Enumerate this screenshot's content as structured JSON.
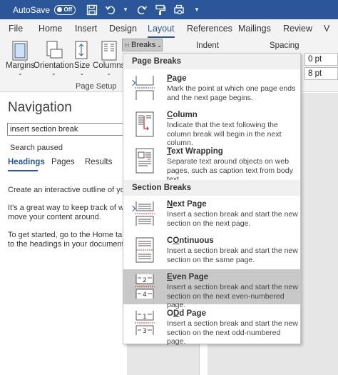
{
  "titlebar": {
    "autosave_label": "AutoSave",
    "autosave_state": "Off",
    "qat_icons": [
      "save-icon",
      "undo-icon",
      "redo-icon",
      "format-painter-icon",
      "print-preview-icon",
      "customize-qat-icon"
    ]
  },
  "tabs": [
    "File",
    "Home",
    "Insert",
    "Design",
    "Layout",
    "References",
    "Mailings",
    "Review",
    "V"
  ],
  "active_tab": "Layout",
  "ribbon": {
    "margins": "Margins",
    "orientation": "Orientation",
    "size": "Size",
    "columns": "Columns",
    "breaks": "Breaks",
    "group_page_setup": "Page Setup",
    "indent": "Indent",
    "spacing": "Spacing",
    "spacing_before": "0 pt",
    "spacing_after": "8 pt"
  },
  "nav": {
    "title": "Navigation",
    "search_value": "insert section break",
    "status": "Search paused",
    "tabs": [
      "Headings",
      "Pages",
      "Results"
    ],
    "p1": "Create an interactive outline of your do",
    "p2_l1": "It's a great way to keep track of where y",
    "p2_l2": "move your content around.",
    "p3_l1": "To get started, go to the Home tab and",
    "p3_l2": "to the headings in your document."
  },
  "breaks_menu": {
    "page_breaks_header": "Page Breaks",
    "section_breaks_header": "Section Breaks",
    "items": [
      {
        "title": "Page",
        "u": "P",
        "rest": "age",
        "desc": "Mark the point at which one page ends and the next page begins."
      },
      {
        "title": "Column",
        "u": "C",
        "rest": "olumn",
        "desc": "Indicate that the text following the column break will begin in the next column."
      },
      {
        "title": "Text Wrapping",
        "u": "T",
        "rest": "ext Wrapping",
        "desc": "Separate text around objects on web pages, such as caption text from body text."
      },
      {
        "title": "Next Page",
        "u": "N",
        "rest": "ext Page",
        "desc": "Insert a section break and start the new section on the next page."
      },
      {
        "title": "Continuous",
        "u": "O",
        "rest": "ntinuous",
        "desc": "Insert a section break and start the new section on the same page."
      },
      {
        "title": "Even Page",
        "u": "E",
        "rest": "ven Page",
        "desc": "Insert a section break and start the new section on the next even-numbered page."
      },
      {
        "title": "Odd Page",
        "u": "D",
        "rest": "d Page",
        "desc": "Insert a section break and start the new section on the next odd-numbered page."
      }
    ]
  },
  "colors": {
    "accent": "#2b579a",
    "hover": "#c8c8c8",
    "marker": "#d13438"
  }
}
